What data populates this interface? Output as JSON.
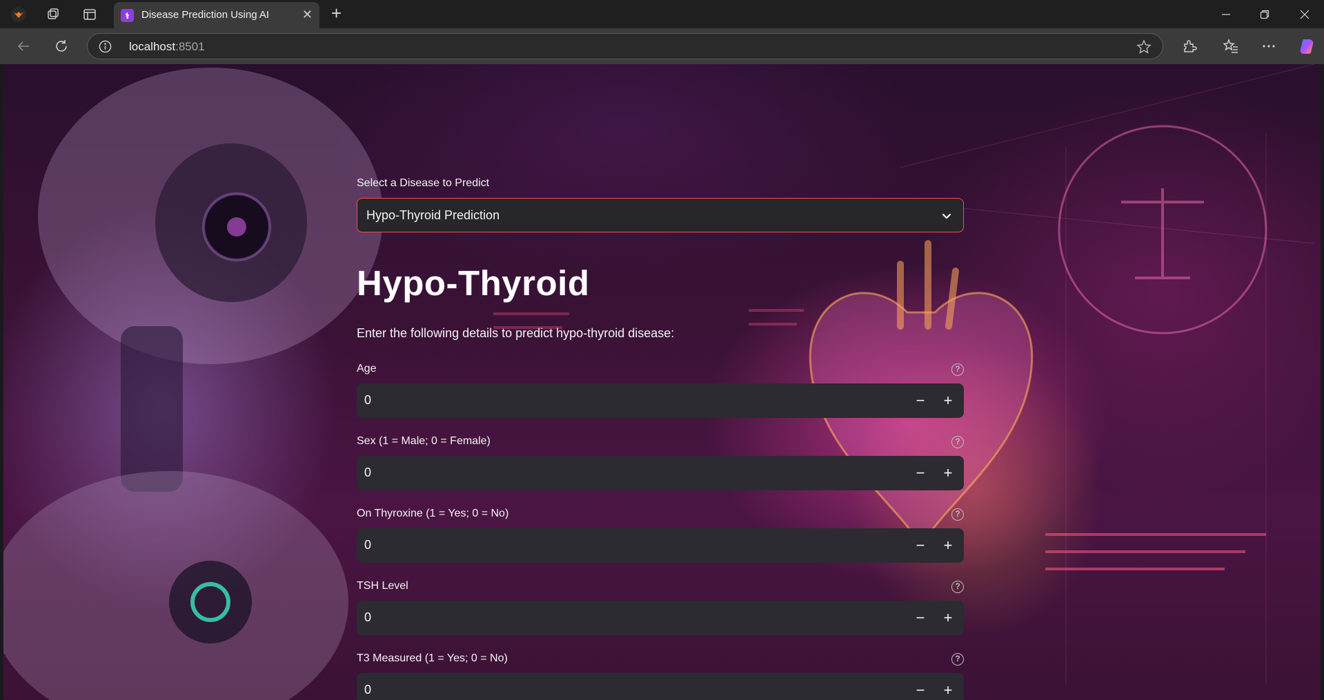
{
  "browser": {
    "tab_title": "Disease Prediction Using AI",
    "url_host": "localhost",
    "url_port": ":8501",
    "new_tab_symbol": "+",
    "close_symbol": "✕"
  },
  "select": {
    "label": "Select a Disease to Predict",
    "value": "Hypo-Thyroid Prediction"
  },
  "main": {
    "title": "Hypo-Thyroid",
    "subtitle": "Enter the following details to predict hypo-thyroid disease:"
  },
  "fields": [
    {
      "label": "Age",
      "value": "0"
    },
    {
      "label": "Sex (1 = Male; 0 = Female)",
      "value": "0"
    },
    {
      "label": "On Thyroxine (1 = Yes; 0 = No)",
      "value": "0"
    },
    {
      "label": "TSH Level",
      "value": "0"
    },
    {
      "label": "T3 Measured (1 = Yes; 0 = No)",
      "value": "0"
    }
  ],
  "stepper": {
    "minus": "−",
    "plus": "+",
    "help": "?"
  },
  "colors": {
    "accent": "#ff4b4b",
    "input_bg": "#2b2b31"
  }
}
